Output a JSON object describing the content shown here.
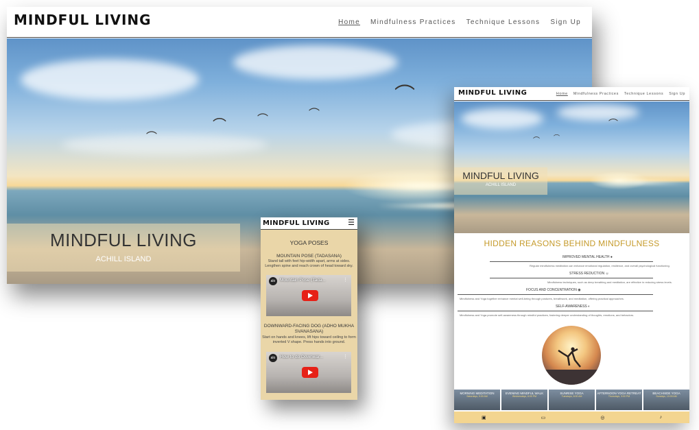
{
  "site": {
    "logo": "MINDFUL LIVING",
    "nav": [
      "Home",
      "Mindfulness Practices",
      "Technique Lessons",
      "Sign Up"
    ]
  },
  "hero": {
    "title": "MINDFUL LIVING",
    "subtitle": "ACHILL ISLAND"
  },
  "tablet": {
    "heading": "HIDDEN REASONS BEHIND MINDFULNESS",
    "accordion": [
      {
        "title": "IMPROVED MENTAL HEALTH",
        "icon": "brain-icon",
        "body": "Regular mindfulness meditation can enhance emotional regulation, resilience, and overall psychological functioning."
      },
      {
        "title": "STRESS REDUCTION",
        "icon": "smile-icon",
        "body": "Mindfulness techniques, such as deep breathing and meditation, are effective in reducing stress levels."
      },
      {
        "title": "FOCUS AND CONCENTRATION",
        "icon": "eye-icon",
        "body": "Mindfulness and Yoga together enhance mental well-being through postures, breathwork, and meditation, offering practical approaches."
      },
      {
        "title": "SELF-AWARENESS",
        "icon": "half-circle-icon",
        "body": "Mindfulness and Yoga promote self-awareness through mindful practices, fostering deeper understanding of thoughts, emotions, and behaviors."
      }
    ],
    "events": [
      {
        "name": "MORNING MEDITATION",
        "detail": "Saturdays, 9:00 AM"
      },
      {
        "name": "EVENING MINDFUL WALK",
        "detail": "Wednesdays, 6:00 PM"
      },
      {
        "name": "SUNRISE YOGA",
        "detail": "Tuesdays, 6:00 AM"
      },
      {
        "name": "AFTERNOON YOGA RETREAT",
        "detail": "Thursdays, 3:00 PM"
      },
      {
        "name": "BEACHSIDE YOGA",
        "detail": "Sundays, 10:00 AM"
      }
    ],
    "footer_icons": [
      "facebook-icon",
      "youtube-icon",
      "instagram-icon",
      "tiktok-icon"
    ]
  },
  "phone": {
    "section_title": "YOGA POSES",
    "poses": [
      {
        "name": "MOUNTAIN POSE (TADASANA)",
        "desc": "Stand tall with feet hip-width apart, arms at sides. Lengthen spine and reach crown of head toward sky.",
        "video_title": "Mountain Pose (Tada..."
      },
      {
        "name": "DOWNWARD-FACING DOG (ADHO MUKHA SVANASANA)",
        "desc": "Start on hands and knees, lift hips toward ceiling to form inverted V shape. Press hands into ground.",
        "video_title": "How to do Downwar..."
      }
    ]
  },
  "colors": {
    "accent": "#c59a2a",
    "footer": "#f3d590",
    "phone_bg": "#ead6a8"
  }
}
